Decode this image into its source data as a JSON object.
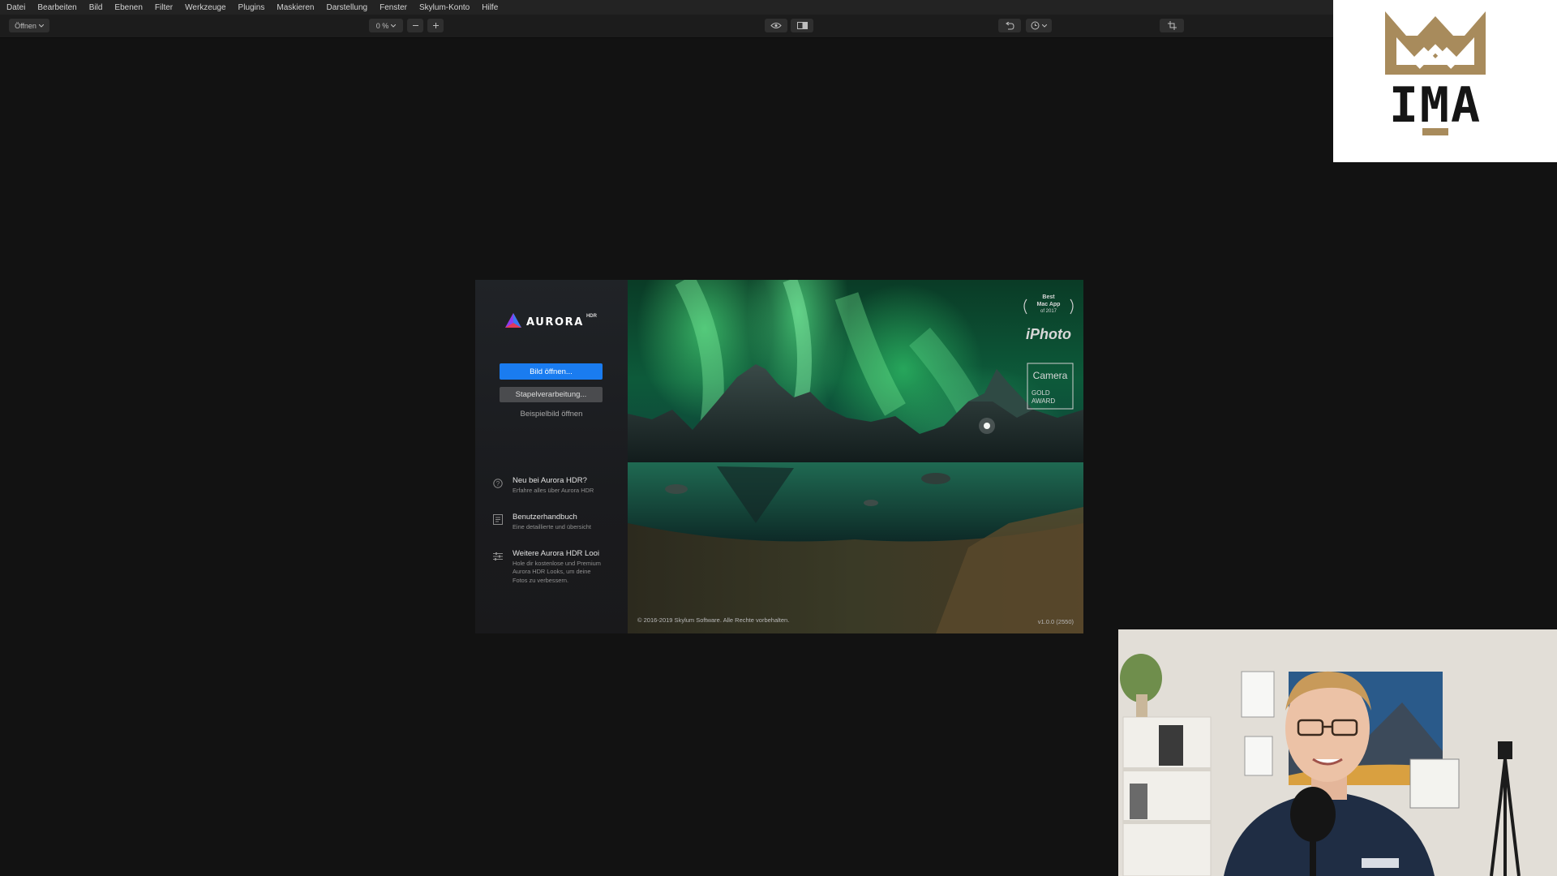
{
  "menu": [
    "Datei",
    "Bearbeiten",
    "Bild",
    "Ebenen",
    "Filter",
    "Werkzeuge",
    "Plugins",
    "Maskieren",
    "Darstellung",
    "Fenster",
    "Skylum-Konto",
    "Hilfe"
  ],
  "toolbar": {
    "open_label": "Öffnen",
    "zoom_value": "0 %"
  },
  "logo": {
    "text": "IMA",
    "color": "#a88b5c"
  },
  "splash": {
    "brand": "AURORA",
    "brand_sup": "HDR",
    "open_button": "Bild öffnen...",
    "batch_button": "Stapelverarbeitung...",
    "sample_link": "Beispielbild öffnen",
    "items": [
      {
        "title": "Neu bei Aurora HDR?",
        "desc": "Erfahre alles über Aurora HDR",
        "icon": "question-icon"
      },
      {
        "title": "Benutzerhandbuch",
        "desc": "Eine detaillierte und übersicht",
        "icon": "book-icon"
      },
      {
        "title": "Weitere Aurora HDR Looi",
        "desc": "Hole dir kostenlose und Premium Aurora HDR Looks, um deine Fotos zu verbessern.",
        "icon": "sliders-icon"
      }
    ],
    "copyright": "© 2016-2019 Skylum Software. Alle Rechte vorbehalten.",
    "version": "v1.0.0 (2550)",
    "awards": {
      "best_mac_app": [
        "Best",
        "Mac App",
        "of 2017"
      ],
      "iphoto": "iPhoto",
      "camera": "Camera",
      "gold_award": [
        "GOLD",
        "AWARD"
      ]
    }
  },
  "colors": {
    "accent": "#1a7cf0",
    "menubar_bg": "#232323",
    "canvas_bg": "#121212"
  }
}
